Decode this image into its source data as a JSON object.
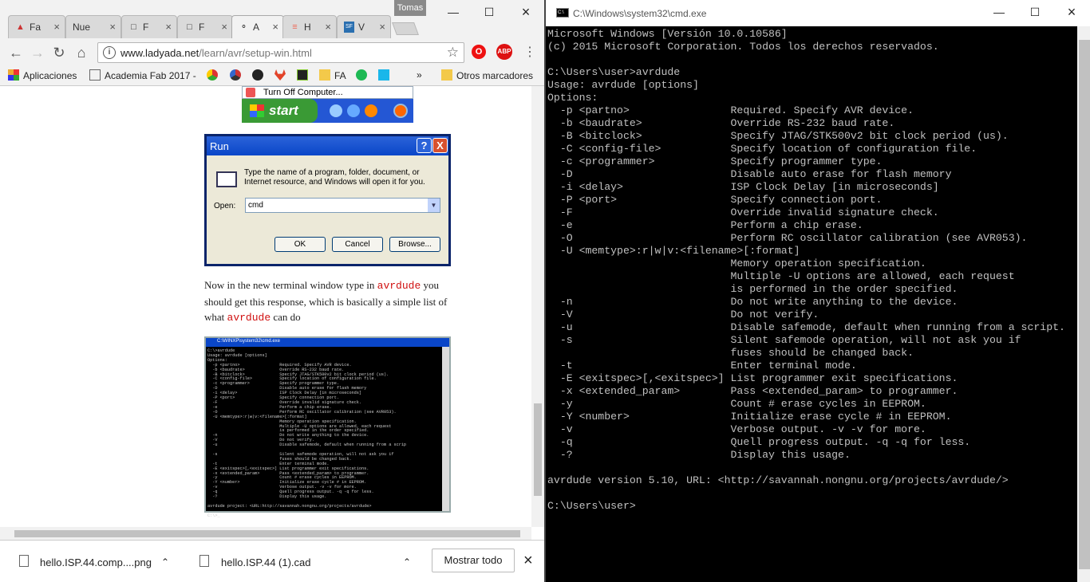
{
  "browser": {
    "profile": "Tomas",
    "tabs": [
      {
        "label": "Fa",
        "icon": "fab-icon"
      },
      {
        "label": "Nue",
        "icon": "none"
      },
      {
        "label": "F",
        "icon": "page-icon"
      },
      {
        "label": "F",
        "icon": "page-icon"
      },
      {
        "label": "A",
        "icon": "ladyada-icon"
      },
      {
        "label": "H",
        "icon": "html-icon"
      },
      {
        "label": "V",
        "icon": "sf-icon"
      }
    ],
    "url_domain": "www.ladyada.net",
    "url_path": "/learn/avr/setup-win.html",
    "bookmarks": [
      "Aplicaciones",
      "Academia Fab 2017 -",
      "FA",
      "Otros marcadores"
    ],
    "bookmarks_more": "»",
    "downloads": [
      {
        "name": "hello.ISP.44.comp....png"
      },
      {
        "name": "hello.ISP.44 (1).cad"
      }
    ],
    "show_all": "Mostrar todo"
  },
  "page": {
    "xp_menu_item": "Turn Off Computer...",
    "xp_start": "start",
    "run_dialog": {
      "title": "Run",
      "help": "?",
      "close": "X",
      "description": "Type the name of a program, folder, document, or Internet resource, and Windows will open it for you.",
      "open_label": "Open:",
      "open_value": "cmd",
      "ok": "OK",
      "cancel": "Cancel",
      "browse": "Browse..."
    },
    "para_1": "Now in the new terminal window type in ",
    "para_code_1": "avrdude",
    "para_2": " you should get this response, which is basically a simple list of what ",
    "para_code_2": "avrdude",
    "para_3": "  can do",
    "screenshot_title": "C:\\WINXP\\system32\\cmd.exe",
    "screenshot_text": "C:\\>avrdude\nUsage: avrdude [options]\nOptions:\n  -p <partno>                Required. Specify AVR device.\n  -b <baudrate>              Override RS-232 baud rate.\n  -B <bitclock>              Specify JTAG/STK500v2 bit clock period (us).\n  -C <config-file>           Specify location of configuration file.\n  -c <programmer>            Specify programmer type.\n  -D                         Disable auto erase for flash memory\n  -i <delay>                 ISP Clock Delay [in microseconds]\n  -P <port>                  Specify connection port.\n  -F                         Override invalid signature check.\n  -e                         Perform a chip erase.\n  -O                         Perform RC oscillator calibration (see AVR053).\n  -U <memtype>:r|w|v:<filename>[:format]\n                             Memory operation specification.\n                             Multiple -U options are allowed, each request\n                             is performed in the order specified.\n  -n                         Do not write anything to the device.\n  -V                         Do not verify.\n  -u                         Disable safemode, default when running from a scrip\n\n  -s                         Silent safemode operation, will not ask you if\n                             fuses should be changed back.\n  -t                         Enter terminal mode.\n  -E <exitspec>[,<exitspec>] List programmer exit specifications.\n  -x <extended_param>        Pass <extended_param> to programmer.\n  -y                         Count # erase cycles in EEPROM.\n  -Y <number>                Initialize erase cycle # in EEPROM.\n  -v                         Verbose output. -v -v for more.\n  -q                         Quell progress output. -q -q for less.\n  -?                         Display this usage.\n\navrdude project: <URL:http://savannah.nongnu.org/projects/avrdude>\n\nC:\\>_"
  },
  "cmd": {
    "title": "C:\\Windows\\system32\\cmd.exe",
    "output": "Microsoft Windows [Versión 10.0.10586]\n(c) 2015 Microsoft Corporation. Todos los derechos reservados.\n\nC:\\Users\\user>avrdude\nUsage: avrdude [options]\nOptions:\n  -p <partno>                Required. Specify AVR device.\n  -b <baudrate>              Override RS-232 baud rate.\n  -B <bitclock>              Specify JTAG/STK500v2 bit clock period (us).\n  -C <config-file>           Specify location of configuration file.\n  -c <programmer>            Specify programmer type.\n  -D                         Disable auto erase for flash memory\n  -i <delay>                 ISP Clock Delay [in microseconds]\n  -P <port>                  Specify connection port.\n  -F                         Override invalid signature check.\n  -e                         Perform a chip erase.\n  -O                         Perform RC oscillator calibration (see AVR053).\n  -U <memtype>:r|w|v:<filename>[:format]\n                             Memory operation specification.\n                             Multiple -U options are allowed, each request\n                             is performed in the order specified.\n  -n                         Do not write anything to the device.\n  -V                         Do not verify.\n  -u                         Disable safemode, default when running from a script.\n  -s                         Silent safemode operation, will not ask you if\n                             fuses should be changed back.\n  -t                         Enter terminal mode.\n  -E <exitspec>[,<exitspec>] List programmer exit specifications.\n  -x <extended_param>        Pass <extended_param> to programmer.\n  -y                         Count # erase cycles in EEPROM.\n  -Y <number>                Initialize erase cycle # in EEPROM.\n  -v                         Verbose output. -v -v for more.\n  -q                         Quell progress output. -q -q for less.\n  -?                         Display this usage.\n\navrdude version 5.10, URL: <http://savannah.nongnu.org/projects/avrdude/>\n\nC:\\Users\\user>"
  }
}
